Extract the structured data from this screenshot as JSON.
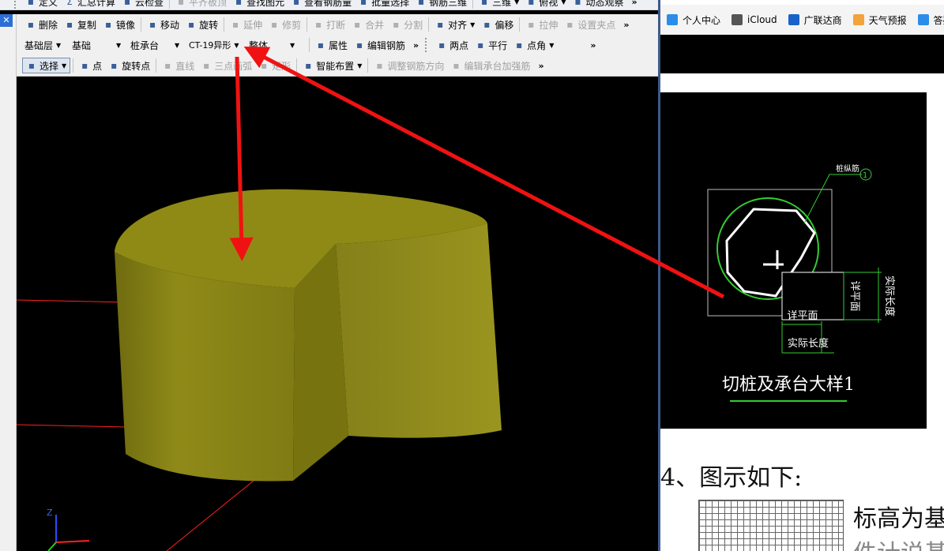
{
  "toolbar_top": [
    {
      "label": "定义",
      "icon": "define-icon"
    },
    {
      "label": "汇总计算",
      "icon": "sigma-icon",
      "prefix": "Σ"
    },
    {
      "label": "云检查",
      "icon": "cloud-check-icon"
    },
    {
      "label": "平齐板顶",
      "icon": "align-top-icon",
      "disabled": true
    },
    {
      "label": "查找图元",
      "icon": "find-element-icon"
    },
    {
      "label": "查看钢筋量",
      "icon": "view-rebar-icon"
    },
    {
      "label": "批量选择",
      "icon": "batch-select-icon"
    },
    {
      "label": "钢筋三维",
      "icon": "rebar-3d-icon"
    },
    {
      "label": "三维",
      "icon": "3d-view-icon",
      "dropdown": true
    },
    {
      "label": "俯视",
      "icon": "top-view-icon",
      "dropdown": true
    },
    {
      "label": "动态观察",
      "icon": "orbit-icon"
    }
  ],
  "toolbar_edit": [
    {
      "label": "删除",
      "icon": "delete-icon"
    },
    {
      "label": "复制",
      "icon": "copy-icon"
    },
    {
      "label": "镜像",
      "icon": "mirror-icon"
    },
    {
      "label": "移动",
      "icon": "move-icon"
    },
    {
      "label": "旋转",
      "icon": "rotate-icon"
    },
    {
      "label": "延伸",
      "icon": "extend-icon",
      "disabled": true
    },
    {
      "label": "修剪",
      "icon": "trim-icon",
      "disabled": true
    },
    {
      "label": "打断",
      "icon": "break-icon",
      "disabled": true
    },
    {
      "label": "合并",
      "icon": "merge-icon",
      "disabled": true
    },
    {
      "label": "分割",
      "icon": "split-icon",
      "disabled": true
    },
    {
      "label": "对齐",
      "icon": "align-icon",
      "dropdown": true
    },
    {
      "label": "偏移",
      "icon": "offset-icon"
    },
    {
      "label": "拉伸",
      "icon": "stretch-icon",
      "disabled": true
    },
    {
      "label": "设置夹点",
      "icon": "grip-point-icon",
      "disabled": true
    }
  ],
  "selectors": {
    "floor": "基础层",
    "category": "基础",
    "type": "桩承台",
    "component": "CT-19异形",
    "part": "整体"
  },
  "toolbar_props": [
    {
      "label": "属性",
      "icon": "properties-icon"
    },
    {
      "label": "编辑钢筋",
      "icon": "edit-rebar-icon"
    }
  ],
  "toolbar_snap": [
    {
      "label": "两点",
      "icon": "two-point-icon"
    },
    {
      "label": "平行",
      "icon": "parallel-icon"
    },
    {
      "label": "点角",
      "icon": "point-angle-icon",
      "dropdown": true
    }
  ],
  "toolbar_draw": [
    {
      "label": "选择",
      "icon": "select-cursor-icon",
      "pressed": true,
      "dropdown": true
    },
    {
      "label": "点",
      "icon": "point-icon"
    },
    {
      "label": "旋转点",
      "icon": "rotate-point-icon"
    },
    {
      "label": "直线",
      "icon": "line-icon",
      "disabled": true
    },
    {
      "label": "三点画弧",
      "icon": "arc-icon",
      "disabled": true
    },
    {
      "label": "矩形",
      "icon": "rectangle-icon",
      "disabled": true
    },
    {
      "label": "智能布置",
      "icon": "smart-layout-icon",
      "dropdown": true
    },
    {
      "label": "调整钢筋方向",
      "icon": "adjust-rebar-icon",
      "disabled": true
    },
    {
      "label": "编辑承台加强筋",
      "icon": "edit-cap-rebar-icon",
      "disabled": true
    }
  ],
  "bookmarks": [
    {
      "label": "个人中心",
      "icon": "bookmark-icon",
      "color": "#2b8de8"
    },
    {
      "label": "iCloud",
      "icon": "apple-icon",
      "color": "#555555"
    },
    {
      "label": "广联达商",
      "icon": "glodon-icon",
      "color": "#1a62c9"
    },
    {
      "label": "天气预报",
      "icon": "weather-icon",
      "color": "#f2a33a"
    },
    {
      "label": "答疑",
      "icon": "bookmark-icon",
      "color": "#2b8de8"
    }
  ],
  "drawing": {
    "rebar_label": "桩纵筋",
    "rebar_no": "1",
    "dim_plan": "详平面",
    "dim_actual": "实际长度",
    "title": "切桩及承台大样1"
  },
  "doc": {
    "step": "4、图示如下:",
    "note": "标高为基准",
    "note2": "件计说基"
  },
  "axes": {
    "z": "Z"
  },
  "colors": {
    "arrow": "#f01212",
    "solid": "#8a8514",
    "cad_green": "#33cc33"
  }
}
